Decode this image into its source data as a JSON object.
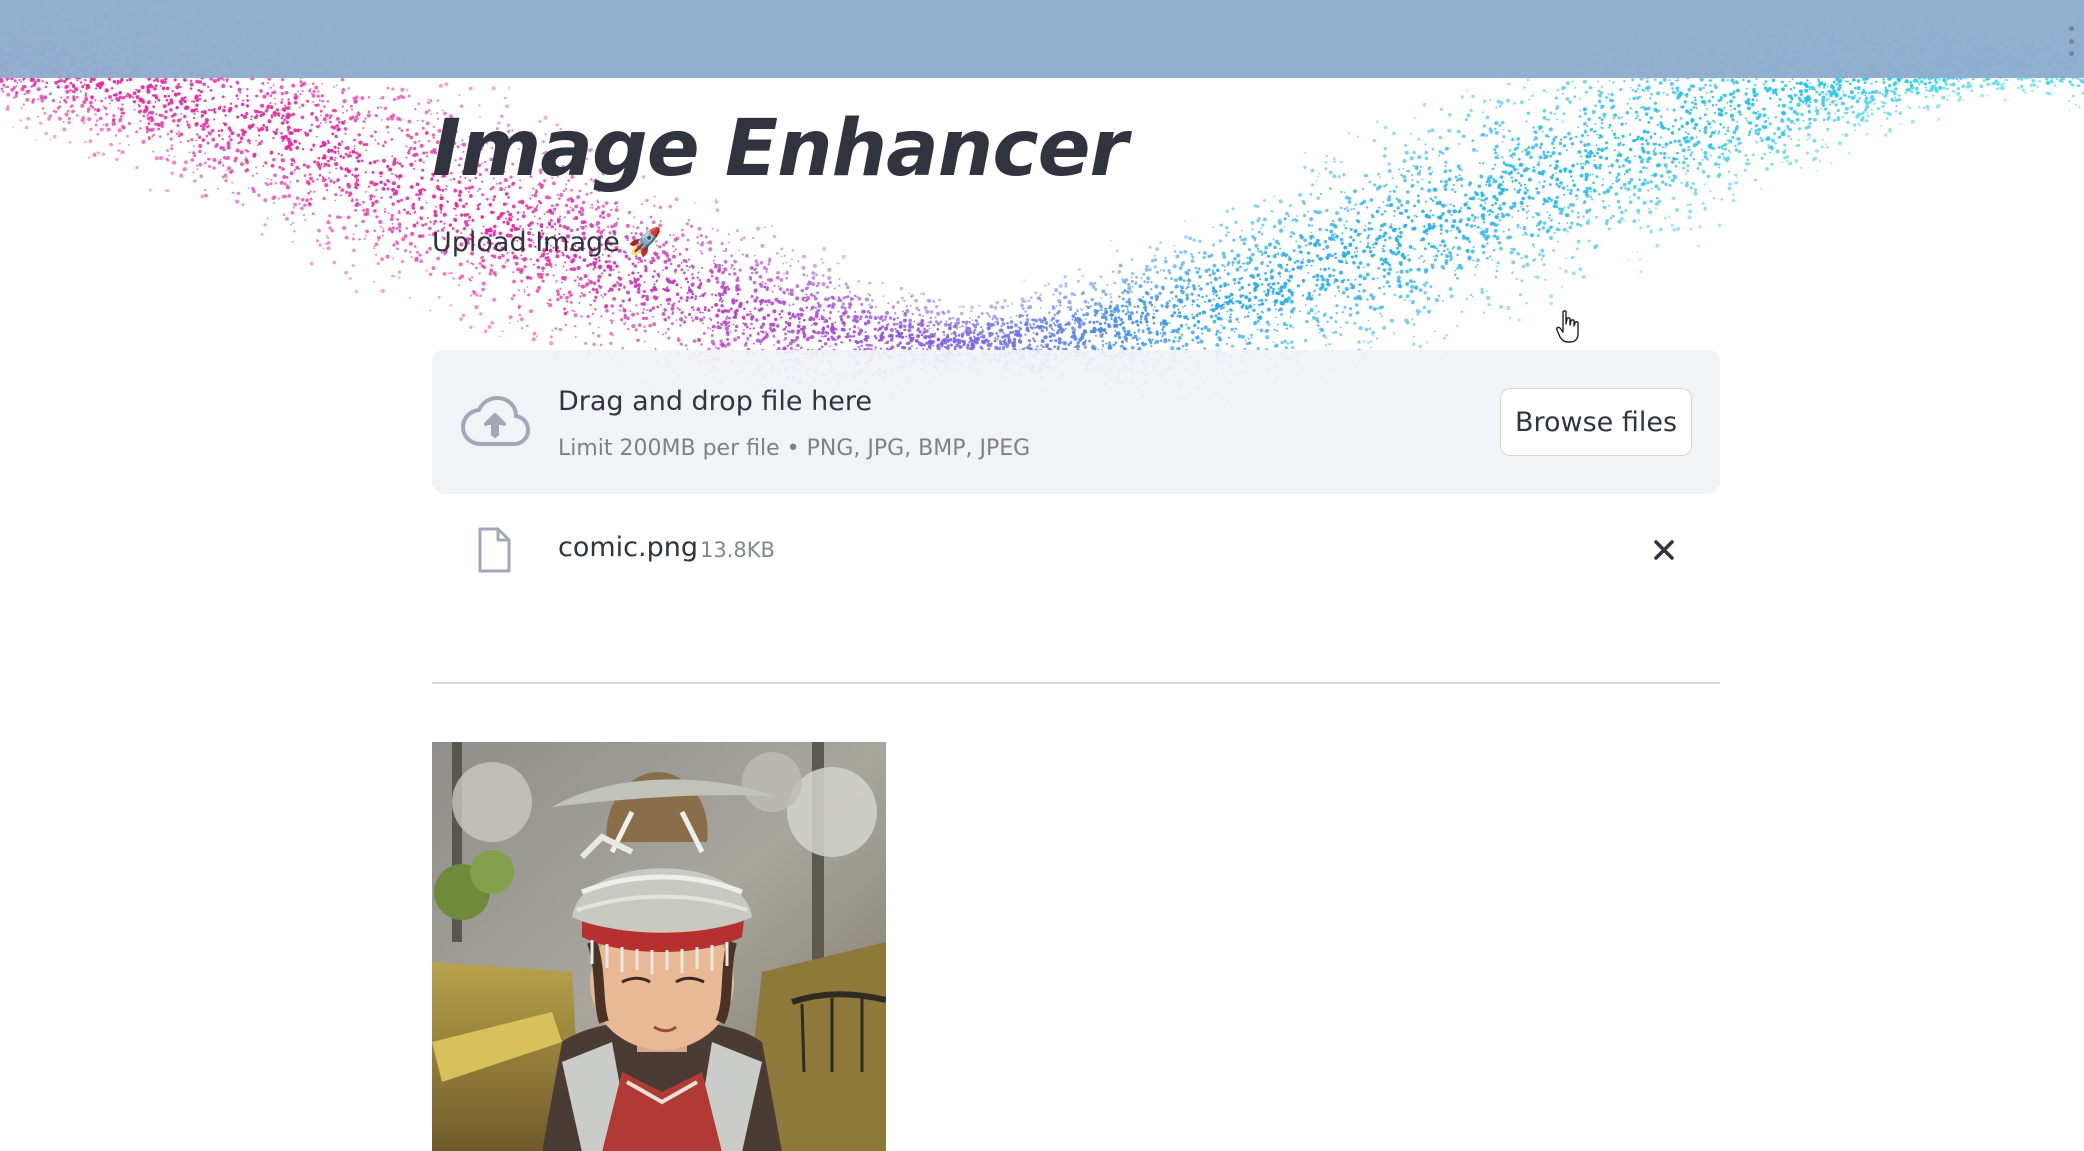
{
  "app": {
    "title": "Image Enhancer",
    "upload_label": "Upload Image 🚀"
  },
  "uploader": {
    "drop_title": "Drag and drop file here",
    "drop_subtitle": "Limit 200MB per file • PNG, JPG, BMP, JPEG",
    "browse_label": "Browse files",
    "cloud_icon": "cloud-upload-icon"
  },
  "file": {
    "name": "comic.png",
    "size": "13.8KB",
    "file_icon": "file-icon",
    "remove_icon": "close-icon"
  },
  "preview": {
    "icon": "image-preview"
  },
  "colors": {
    "header": "#8eaccd",
    "magenta": "#e8259f",
    "purple": "#9a4fe0",
    "blue": "#2aa8f0",
    "cyan": "#1fd5e8",
    "dropzone_bg": "#f0f2f6",
    "text": "#31333f"
  }
}
